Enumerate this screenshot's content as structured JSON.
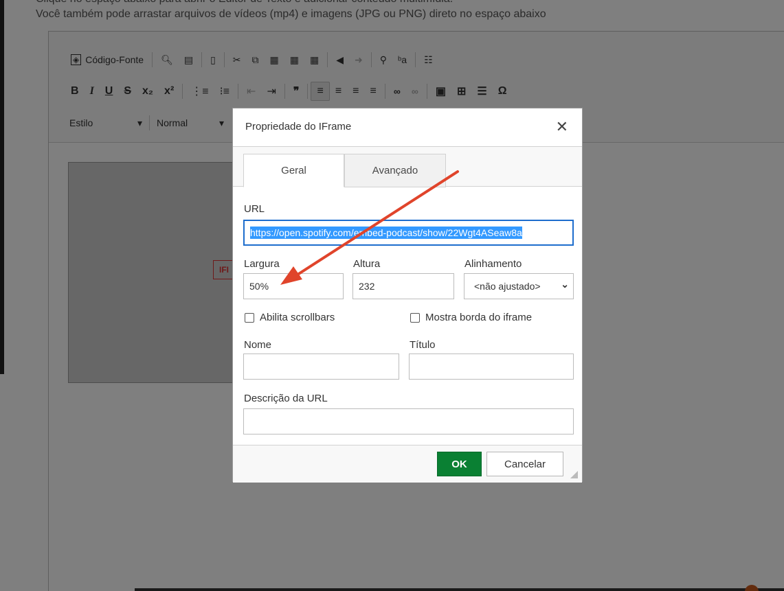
{
  "page": {
    "line1": "Clique no espaço abaixo para abrir o Editor de Texto e adicionar conteúdo multimídia.",
    "line2": "Você também pode arrastar arquivos de vídeos (mp4) e imagens (JPG ou PNG) direto no espaço abaixo"
  },
  "toolbar": {
    "source_label": "Código-Fonte",
    "style_combo": "Estilo",
    "format_combo": "Normal",
    "combo_arrow": "▾",
    "row1_icons": [
      "preview-icon",
      "print-icon",
      "templates-icon",
      "cut-icon",
      "copy-icon",
      "paste-icon",
      "paste-text-icon",
      "paste-word-icon",
      "undo-icon",
      "redo-icon",
      "find-icon",
      "replace-icon",
      "select-all-icon"
    ],
    "row2_glyphs": {
      "bold": "B",
      "italic": "I",
      "underline": "U",
      "strike": "S",
      "subscript": "x₂",
      "superscript": "x²",
      "numbered": "⋮≡",
      "bulleted": "⁝≡",
      "outdent": "⇤",
      "indent": "⇥",
      "blockquote": "❞",
      "align_left": "≡",
      "align_center": "≡",
      "align_right": "≡",
      "justify": "≡",
      "link": "🔗",
      "unlink": "⛓",
      "image": "▣",
      "table": "⊞",
      "hline": "☰",
      "special_char": "Ω"
    }
  },
  "placeholder": {
    "tag": "IFI"
  },
  "dialog": {
    "title": "Propriedade do IFrame",
    "close_glyph": "✕",
    "tabs": [
      {
        "label": "Geral",
        "active": true
      },
      {
        "label": "Avançado",
        "active": false
      }
    ],
    "url_label": "URL",
    "url_value": "https://open.spotify.com/embed-podcast/show/22Wgt4ASeaw8a",
    "width_label": "Largura",
    "width_value": "50%",
    "height_label": "Altura",
    "height_value": "232",
    "align_label": "Alinhamento",
    "align_value": "<não ajustado>",
    "align_arrow": "⌄",
    "scroll_label": "Abilita scrollbars",
    "border_label": "Mostra borda do iframe",
    "name_label": "Nome",
    "name_value": "",
    "title_label": "Título",
    "title_value": "",
    "desc_label": "Descrição da URL",
    "desc_value": "",
    "ok_label": "OK",
    "cancel_label": "Cancelar"
  },
  "colors": {
    "ok_button": "#0a8033",
    "url_focus": "#1d6dcd",
    "arrow": "#e0442b"
  }
}
